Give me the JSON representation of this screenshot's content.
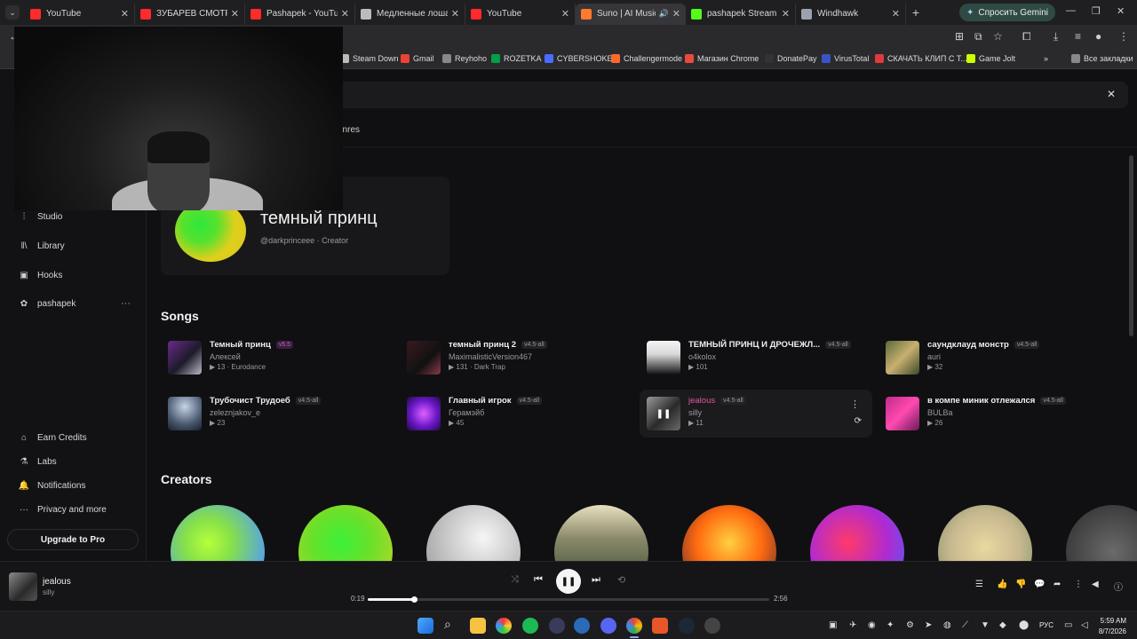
{
  "browser": {
    "tabs": [
      {
        "title": "YouTube",
        "fav": "#ff2a2a",
        "active": false
      },
      {
        "title": "ЗУБАРЕВ СМОТРИТ",
        "fav": "#ff2a2a",
        "active": false
      },
      {
        "title": "Pashapek - YouTube",
        "fav": "#ff2a2a",
        "active": false
      },
      {
        "title": "Медленные лошади",
        "fav": "#bbbbbb",
        "active": false
      },
      {
        "title": "YouTube",
        "fav": "#ff2a2a",
        "active": false
      },
      {
        "title": "Suno | AI Music",
        "fav": "#ff7a2f",
        "active": true
      },
      {
        "title": "pashapek Stream - W",
        "fav": "#53fc18",
        "active": false
      },
      {
        "title": "Windhawk",
        "fav": "#9aa3ad",
        "active": false
      }
    ],
    "new_tab": "+",
    "gemini_label": "Спросить Gemini",
    "bookmarks": [
      {
        "label": "Steam Down",
        "color": "#bbbbbb"
      },
      {
        "label": "Gmail",
        "color": "#ea4335"
      },
      {
        "label": "Reyhoho",
        "color": "#888888"
      },
      {
        "label": "ROZETKA",
        "color": "#00a046"
      },
      {
        "label": "CYBERSHOKE",
        "color": "#4a6cff"
      },
      {
        "label": "Challengermode",
        "color": "#ff6a2b"
      },
      {
        "label": "Магазин Chrome",
        "color": "#e84b3c"
      },
      {
        "label": "DonatePay",
        "color": "#333333"
      },
      {
        "label": "VirusTotal",
        "color": "#3a53c8"
      },
      {
        "label": "СКАЧАТЬ КЛИП С Т...",
        "color": "#e03a3a"
      },
      {
        "label": "Game Jolt",
        "color": "#ccff00"
      }
    ],
    "all_bookmarks": "Все закладки"
  },
  "suno": {
    "tab_label": "enres",
    "sidebar": [
      {
        "label": "Studio",
        "icon": "studio-icon"
      },
      {
        "label": "Library",
        "icon": "library-icon"
      },
      {
        "label": "Hooks",
        "icon": "hooks-icon"
      },
      {
        "label": "pashapek",
        "icon": "user-icon"
      }
    ],
    "sidebar_bottom": [
      {
        "label": "Earn Credits",
        "icon": "earn-credits-icon"
      },
      {
        "label": "Labs",
        "icon": "labs-icon"
      },
      {
        "label": "Notifications",
        "icon": "bell-icon"
      },
      {
        "label": "Privacy and more",
        "icon": "more-icon"
      }
    ],
    "upgrade_label": "Upgrade to Pro",
    "profile": {
      "name": "темный принц",
      "sub": "@darkprinceee · Creator"
    },
    "songs_title": "Songs",
    "creators_title": "Creators",
    "songs": [
      {
        "title": "Темный принц",
        "version": "v5.5",
        "artist": "Алексей",
        "meta": "▶ 13 · Eurodance",
        "cover": "linear-gradient(135deg,#6a2a8a,#1d1b2a 55%,#b9b9c8)"
      },
      {
        "title": "темный принц 2",
        "version": "v4.5-all",
        "artist": "MaximalisticVersion467",
        "meta": "▶ 131 · Dark Trap",
        "cover": "linear-gradient(135deg,#3a1a20,#111 60%,#8a3a4a)"
      },
      {
        "title": "ТЕМНЫЙ ПРИНЦ И ДРОЧЕЖЛ...",
        "version": "v4.5-all",
        "artist": "o4kolox",
        "meta": "▶ 101",
        "cover": "linear-gradient(180deg,#f4f4f4 0%,#d8d8d8 40%,#111 100%)"
      },
      {
        "title": "саундклауд монстр",
        "version": "v4.5-all",
        "artist": "auri",
        "meta": "▶ 32",
        "cover": "linear-gradient(135deg,#5a6a3a,#c8b070 50%,#3a4a2a)"
      },
      {
        "title": "Трубочист Трудоеб",
        "version": "v4.5-all",
        "artist": "zeleznjakov_e",
        "meta": "▶ 23",
        "cover": "radial-gradient(circle at 50% 30%,#c8d4e8,#4a5a70 60%,#1a2030)"
      },
      {
        "title": "Главный игрок",
        "version": "v4.5-all",
        "artist": "Герамэйб",
        "meta": "▶ 45",
        "cover": "radial-gradient(circle at 50% 50%,#e060ff,#6a18c8 55%,#200a40)"
      },
      {
        "title": "jealous",
        "version": "v4.5-all",
        "artist": "silly",
        "meta": "▶ 11",
        "cover": "linear-gradient(135deg,#9a9a9a,#2a2a2a 55%,#6a6a6a)"
      },
      {
        "title": "в компе миник отлежался",
        "version": "v4.5-all",
        "artist": "BULBa",
        "meta": "▶ 26",
        "cover": "linear-gradient(135deg,#c02a8a,#ff4ab0 50%,#6a1a5a)"
      }
    ],
    "creators": [
      {
        "name": "creator-1",
        "bg": "radial-gradient(circle at 40% 40%,#b6ff3a 0%,#86e04a 30%,#5aa8d8 70%,#4a9ad0 100%)"
      },
      {
        "name": "creator-2",
        "bg": "radial-gradient(circle at 45% 40%,#3cf03a 0%,#6ae02a 40%,#d8d02a 100%)"
      },
      {
        "name": "creator-3",
        "bg": "radial-gradient(circle at 60% 35%,#f6f6f6 0%,#bcbcbc 55%,#8a8a8a 100%)"
      },
      {
        "name": "creator-4",
        "bg": "linear-gradient(180deg,#e8e0c0 0%,#8a8a6a 35%,#2a3a2a 100%)"
      },
      {
        "name": "creator-5",
        "bg": "radial-gradient(circle at 50% 40%,#ffd040 0%,#ff6a10 45%,#2a1a3a 100%)"
      },
      {
        "name": "creator-6",
        "bg": "radial-gradient(circle at 40% 40%,#ff3a6a 0%,#b02ad0 50%,#3a6aff 100%)"
      },
      {
        "name": "creator-7",
        "bg": "radial-gradient(circle at 50% 45%,#e8d8a0 0%,#c8b890 50%,#6a8a5a 100%)"
      },
      {
        "name": "creator-8",
        "bg": "radial-gradient(circle at 50% 50%,#6a6a6a 0%,#2a2a2a 100%)"
      }
    ]
  },
  "player": {
    "song": "jealous",
    "artist": "silly",
    "current": "0:19",
    "duration": "2:56",
    "progress": 0.115
  },
  "taskbar": {
    "language": "РУС",
    "time": "5:59 AM",
    "date": "8/7/2026"
  }
}
